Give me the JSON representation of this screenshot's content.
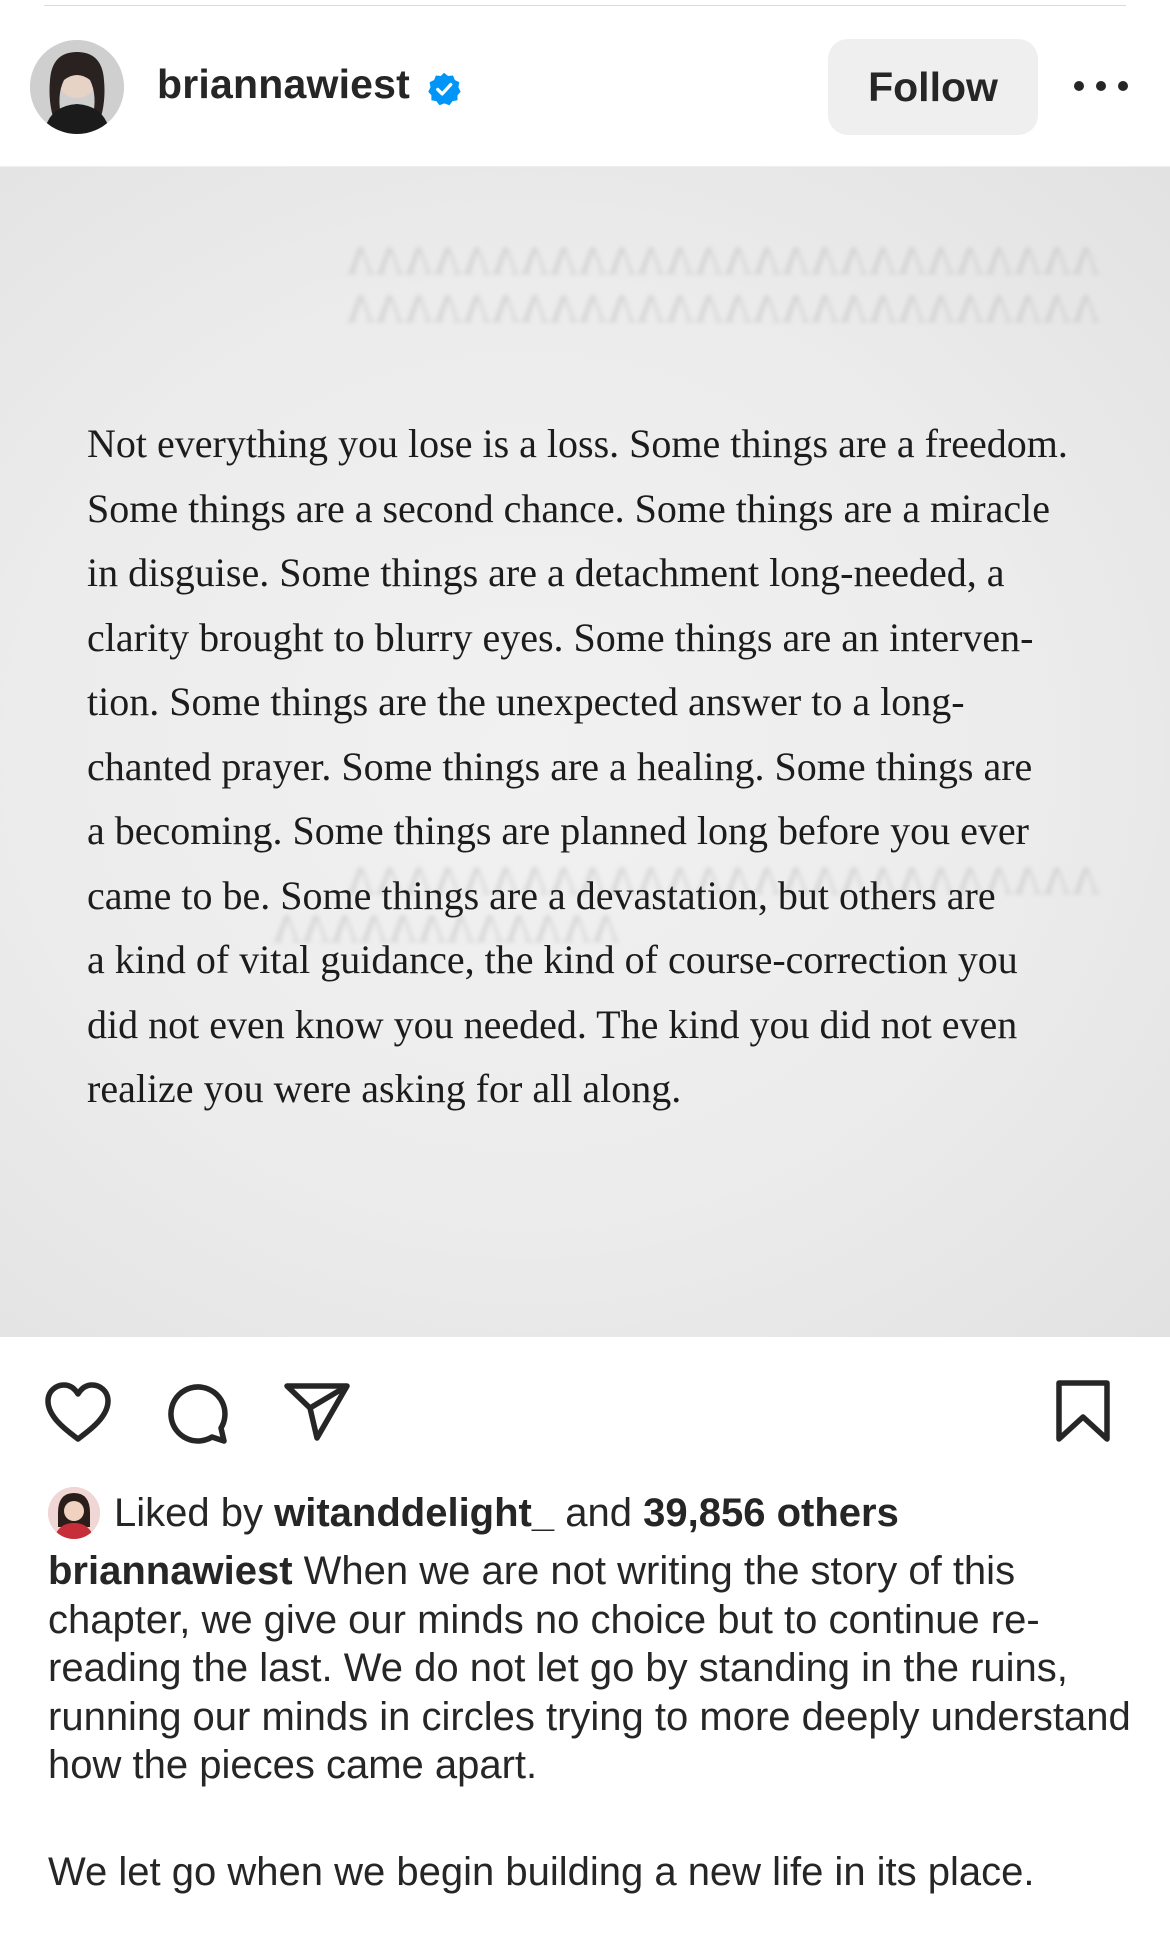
{
  "post": {
    "username": "briannawiest",
    "verified": true,
    "follow_label": "Follow",
    "image_text": "Not everything you lose is a loss. Some things are a freedom. Some things are a second chance. Some things are a miracle in disguise. Some things are a detachment long-needed, a clarity brought to blurry eyes. Some things are an interven-tion. Some things are the unexpected answer to a long-chanted prayer. Some things are a healing. Some things are a becoming. Some things are planned long before you ever came to be. Some things are a devastation, but others are a kind of vital guidance, the kind of course-correction you did not even know you needed. The kind you did not even realize you were asking for all along.",
    "image_lines": [
      "Not everything you lose is a loss. Some things are a freedom.",
      "Some things are a second chance. Some things are a miracle",
      "in disguise. Some things are a detachment long-needed, a",
      "clarity brought to blurry eyes. Some things are an interven-",
      "tion. Some things are the unexpected answer to a long-",
      "chanted prayer. Some things are a healing. Some things are",
      "a becoming. Some things are planned long before you ever",
      "came to be. Some things are a devastation, but others are",
      "a kind of vital guidance, the kind of course-correction you",
      "did not even know you needed. The kind you did not even",
      "realize you were asking for all along."
    ]
  },
  "likes": {
    "prefix": "Liked by",
    "liker": "witanddelight_",
    "conjunction": "and",
    "others": "39,856 others"
  },
  "caption": {
    "username": "briannawiest",
    "paragraph_1": "When we are not writing the story of this chapter, we give our minds no choice but to continue re-reading the last. We do not let go by standing in the ruins, running our minds in circles trying to more deeply understand how the pieces came apart.",
    "paragraph_2": "We let go when we begin building a new life in its place."
  },
  "icons": {
    "more": "more-options-icon",
    "verified": "verified-badge-icon",
    "like": "heart-icon",
    "comment": "comment-icon",
    "share": "send-icon",
    "save": "bookmark-icon"
  },
  "colors": {
    "text": "#262626",
    "verified_blue": "#0095f6",
    "follow_bg": "#efefef",
    "page_bg": "#ececec"
  }
}
